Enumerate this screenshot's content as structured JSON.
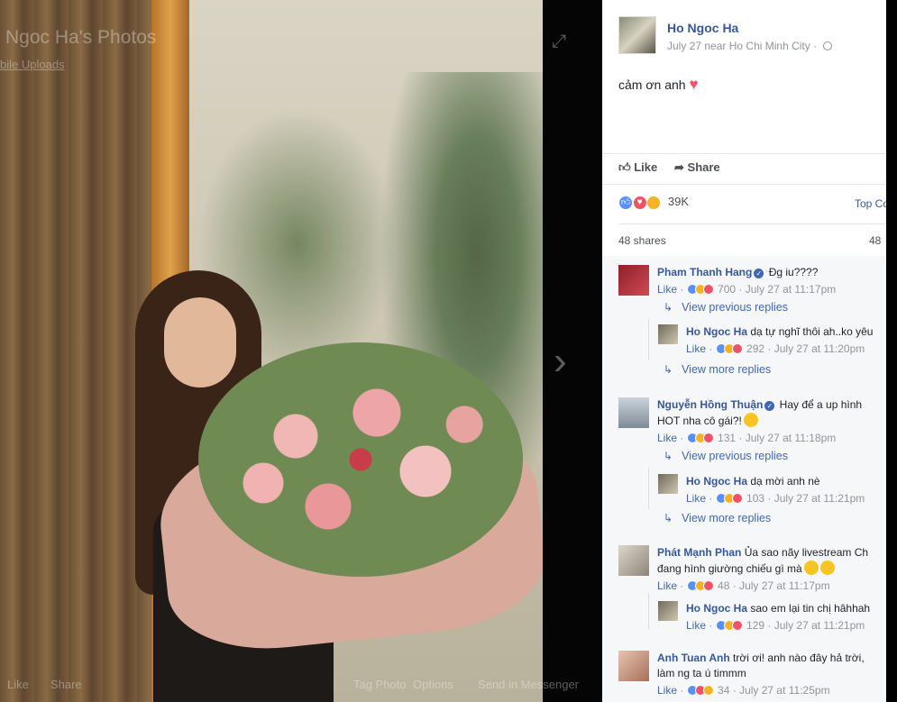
{
  "photo": {
    "title": "Ngoc Ha's Photos",
    "subtitle": "bile Uploads",
    "bottom_bar": [
      "Like",
      "Share",
      "Tag Photo",
      "Options",
      "Send in Messenger"
    ]
  },
  "post": {
    "author": "Ho Ngoc Ha",
    "date": "July 27",
    "location": "near Ho Chi Minh City",
    "text": "cảm ơn anh",
    "actions": {
      "like": "Like",
      "share": "Share"
    },
    "reaction_count": "39K",
    "top_comments": "Top Co",
    "shares": "48 shares",
    "shares_right": "48"
  },
  "comments": [
    {
      "name": "Pham Thanh Hang",
      "verified": true,
      "text": "Đg iu????",
      "like": "Like",
      "reactions": "700",
      "time": "July 27 at 11:17pm",
      "view_previous": "View previous replies",
      "reply": {
        "name": "Ho Ngoc Ha",
        "text": "dạ tự nghĩ thôi ah..ko yêu",
        "like": "Like",
        "reactions": "292",
        "time": "July 27 at 11:20pm"
      },
      "view_more": "View more replies"
    },
    {
      "name": "Nguyễn Hồng Thuận",
      "verified": true,
      "text": "Hay để a up hình",
      "text2": "HOT nha cô gái?!",
      "like": "Like",
      "reactions": "131",
      "time": "July 27 at 11:18pm",
      "view_previous": "View previous replies",
      "reply": {
        "name": "Ho Ngoc Ha",
        "text": "dạ mời anh nè",
        "like": "Like",
        "reactions": "103",
        "time": "July 27 at 11:21pm"
      },
      "view_more": "View more replies"
    },
    {
      "name": "Phát Mạnh Phan",
      "verified": false,
      "text": "Ủa sao nãy livestream Ch",
      "text2": "đang hình giường chiếu gì mà",
      "like": "Like",
      "reactions": "48",
      "time": "July 27 at 11:17pm",
      "reply": {
        "name": "Ho Ngoc Ha",
        "text": "sao em lại tin chị hâhhah",
        "like": "Like",
        "reactions": "129",
        "time": "July 27 at 11:21pm"
      }
    },
    {
      "name": "Anh Tuan Anh",
      "verified": false,
      "text": "trời ơi! anh nào đây hả trời,",
      "text2": "làm ng ta ú timmm",
      "like": "Like",
      "reactions": "34",
      "time": "July 27 at 11:25pm"
    }
  ]
}
